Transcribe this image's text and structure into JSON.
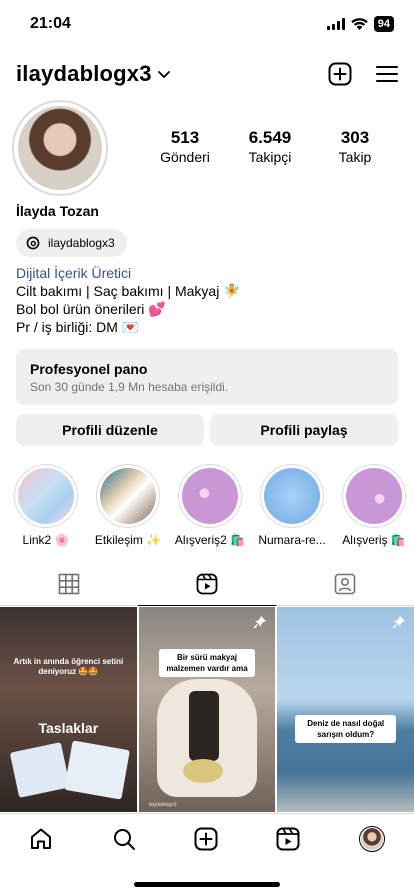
{
  "status": {
    "time": "21:04",
    "battery": "94"
  },
  "header": {
    "username": "ilaydablogx3"
  },
  "profile": {
    "stats": [
      {
        "value": "513",
        "label": "Gönderi"
      },
      {
        "value": "6.549",
        "label": "Takipçi"
      },
      {
        "value": "303",
        "label": "Takip"
      }
    ],
    "full_name": "İlayda Tozan",
    "threads_handle": "ilaydablogx3",
    "category": "Dijital İçerik Üretici",
    "bio_lines": [
      "Cilt bakımı | Saç bakımı | Makyaj 🧚",
      "Bol bol ürün önerileri 💕",
      "Pr / iş birliği: DM 💌"
    ]
  },
  "dashboard": {
    "title": "Profesyonel pano",
    "subtitle": "Son 30 günde 1,9 Mn hesaba erişildi."
  },
  "buttons": {
    "edit_profile": "Profili düzenle",
    "share_profile": "Profili paylaş"
  },
  "highlights": [
    {
      "label": "Link2 🌸"
    },
    {
      "label": "Etkileşim ✨"
    },
    {
      "label": "Alışveriş2 🛍️"
    },
    {
      "label": "Numara-re..."
    },
    {
      "label": "Alışveriş 🛍️"
    }
  ],
  "grid": {
    "drafts_label": "Taslaklar",
    "post1_caption": "Artık in anında öğrenci setini deniyoruz 🤩🤩",
    "post2_caption": "Bir sürü makyaj malzemen vardır ama",
    "post2_watermark": "ilaydablogx3",
    "post3_caption": "Deniz de nasıl doğal sarışın oldum?"
  },
  "icons": {
    "nav": [
      "home-icon",
      "search-icon",
      "create-icon",
      "reels-icon",
      "profile-avatar"
    ],
    "tabs": [
      "grid-icon",
      "reels-tab-icon",
      "tagged-icon"
    ]
  }
}
